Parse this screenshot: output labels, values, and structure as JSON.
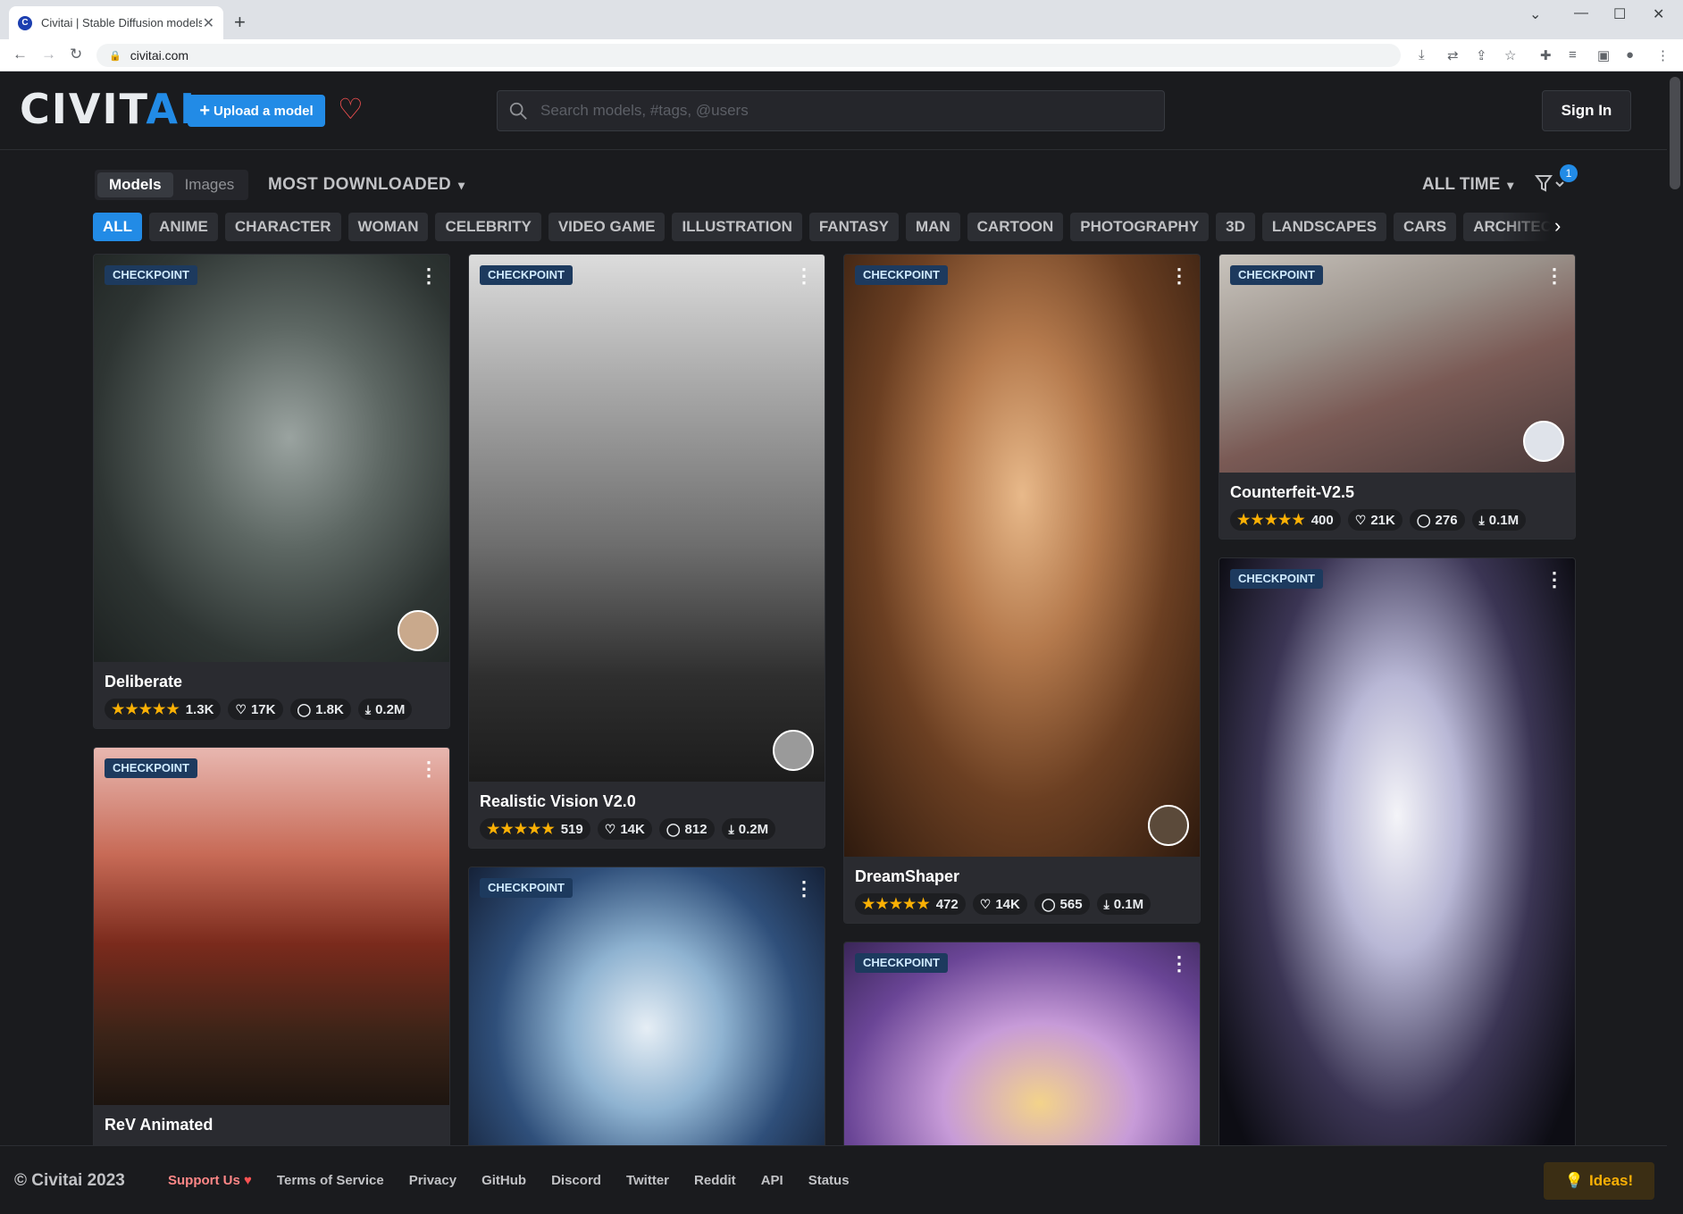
{
  "browser": {
    "tab_title": "Civitai | Stable Diffusion models",
    "favicon": "C",
    "url": "civitai.com"
  },
  "header": {
    "logo_main": "CIVIT",
    "logo_accent": "AI",
    "upload_label": "Upload a model",
    "search_placeholder": "Search models, #tags, @users",
    "signin_label": "Sign In"
  },
  "controls": {
    "tabs": [
      "Models",
      "Images"
    ],
    "active_tab": "Models",
    "sort": "MOST DOWNLOADED",
    "period": "ALL TIME",
    "filter_count": "1"
  },
  "tags": [
    "ALL",
    "ANIME",
    "CHARACTER",
    "WOMAN",
    "CELEBRITY",
    "VIDEO GAME",
    "ILLUSTRATION",
    "FANTASY",
    "MAN",
    "CARTOON",
    "PHOTOGRAPHY",
    "3D",
    "LANDSCAPES",
    "CARS",
    "ARCHITECTURE"
  ],
  "cards": [
    {
      "badge": "CHECKPOINT",
      "title": "Deliberate",
      "rating": "1.3K",
      "likes": "17K",
      "comments": "1.8K",
      "downloads": "0.2M"
    },
    {
      "badge": "CHECKPOINT",
      "title": "Realistic Vision V2.0",
      "rating": "519",
      "likes": "14K",
      "comments": "812",
      "downloads": "0.2M"
    },
    {
      "badge": "CHECKPOINT",
      "title": "DreamShaper",
      "rating": "472",
      "likes": "14K",
      "comments": "565",
      "downloads": "0.1M"
    },
    {
      "badge": "CHECKPOINT",
      "title": "Counterfeit-V2.5",
      "rating": "400",
      "likes": "21K",
      "comments": "276",
      "downloads": "0.1M"
    },
    {
      "badge": "CHECKPOINT",
      "title": "ReV Animated"
    },
    {
      "badge": "CHECKPOINT"
    },
    {
      "badge": "CHECKPOINT"
    },
    {
      "badge": "CHECKPOINT"
    }
  ],
  "footer": {
    "copyright": "© Civitai 2023",
    "links": [
      "Support Us",
      "Terms of Service",
      "Privacy",
      "GitHub",
      "Discord",
      "Twitter",
      "Reddit",
      "API",
      "Status"
    ],
    "ideas_label": "Ideas!"
  }
}
